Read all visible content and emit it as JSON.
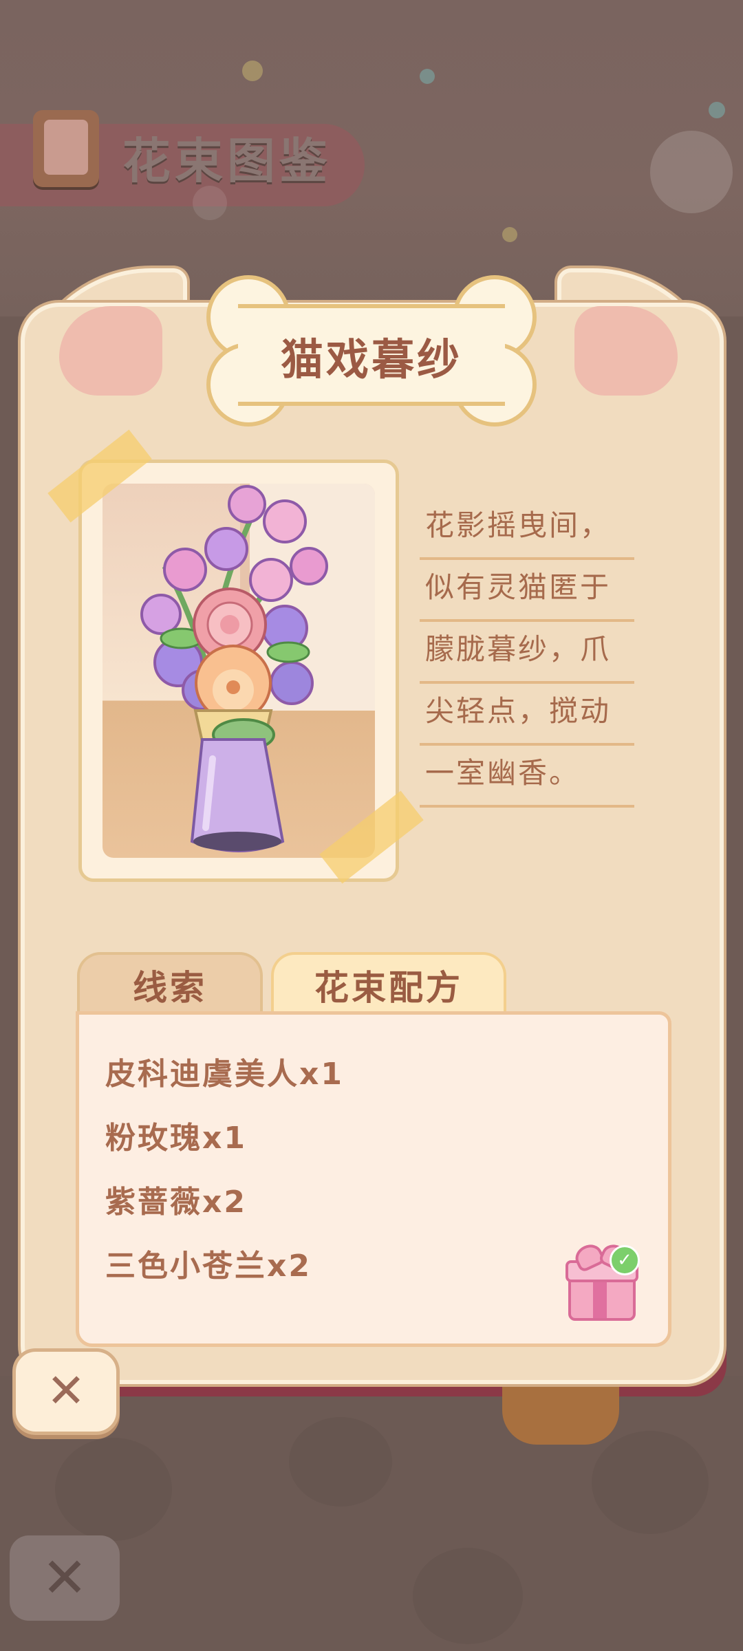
{
  "background": {
    "page_title": "花束图鉴",
    "close_glyph": "✕"
  },
  "card": {
    "title": "猫戏暮纱",
    "description_lines": [
      "花影摇曳间，",
      "似有灵猫匿于",
      "朦胧暮纱，爪",
      "尖轻点，搅动",
      "一室幽香。"
    ],
    "tabs": [
      {
        "label": "线索",
        "active": false
      },
      {
        "label": "花束配方",
        "active": true
      }
    ],
    "recipe": [
      "皮科迪虞美人x1",
      "粉玫瑰x1",
      "紫蔷薇x2",
      "三色小苍兰x2"
    ],
    "gift": {
      "icon": "gift-box-icon",
      "claimed_icon": "checkmark-icon",
      "check_glyph": "✓"
    },
    "close_glyph": "✕"
  },
  "colors": {
    "card_bg": "#f1dcbf",
    "card_border": "#d2ad86",
    "title_text": "#9b5a44",
    "ear_inner": "#efbcae",
    "overlay_bg": "#6e5b55"
  }
}
